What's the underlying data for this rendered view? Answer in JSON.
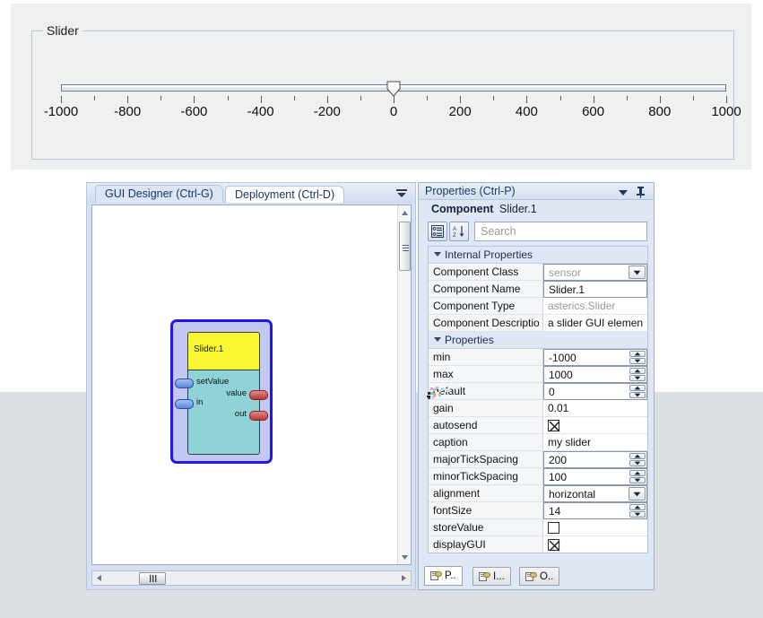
{
  "slider_window": {
    "group_title": "Slider",
    "caption": "my slider",
    "min": -1000,
    "max": 1000,
    "value": 0,
    "major_tick_spacing": 200,
    "minor_tick_spacing": 100,
    "tick_labels": [
      "-1000",
      "-800",
      "-600",
      "-400",
      "-200",
      "0",
      "200",
      "400",
      "600",
      "800",
      "1000"
    ]
  },
  "editor": {
    "tabs": [
      {
        "label": "GUI Designer (Ctrl-G)",
        "selected": true
      },
      {
        "label": "Deployment (Ctrl-D)",
        "selected": false
      }
    ],
    "overflow_icon": "chevron-down-icon",
    "canvas": {
      "component": {
        "title": "Slider.1",
        "inputs": [
          "setValue",
          "in"
        ],
        "outputs": [
          "value",
          "out"
        ]
      }
    },
    "scrollbars": {
      "vertical": {
        "up_icon": "arrow-up-icon",
        "down_icon": "arrow-down-icon"
      },
      "horizontal": {
        "left_icon": "arrow-left-icon",
        "right_icon": "arrow-right-icon"
      }
    }
  },
  "properties_panel": {
    "title": "Properties (Ctrl-P)",
    "collapse_icon": "chevron-down-icon",
    "pin_icon": "pin-icon",
    "component_label": "Component",
    "component_value": "Slider.1",
    "toolbar": {
      "categorize_icon": "categorize-icon",
      "sort_icon": "sort-az-icon",
      "search_placeholder": "Search",
      "search_value": ""
    },
    "sections": [
      {
        "name": "Internal Properties",
        "rows": [
          {
            "key": "Component Class",
            "value": "sensor",
            "editor": "combo",
            "muted": true
          },
          {
            "key": "Component Name",
            "value": "Slider.1",
            "editor": "text",
            "muted": false
          },
          {
            "key": "Component Type",
            "value": "asterics.Slider",
            "editor": "text-plain",
            "muted": true
          },
          {
            "key": "Component Descriptio",
            "value": "a slider GUI elemen",
            "editor": "text-plain",
            "muted": false
          }
        ]
      },
      {
        "name": "Properties",
        "rows": [
          {
            "key": "min",
            "value": "-1000",
            "editor": "spinner",
            "muted": false
          },
          {
            "key": "max",
            "value": "1000",
            "editor": "spinner",
            "muted": false
          },
          {
            "key": "default",
            "value": "0",
            "editor": "spinner",
            "muted": false
          },
          {
            "key": "gain",
            "value": "0.01",
            "editor": "text-plain",
            "muted": false
          },
          {
            "key": "autosend",
            "value": "checked",
            "editor": "checkbox",
            "muted": false
          },
          {
            "key": "caption",
            "value": "my slider",
            "editor": "text-plain",
            "muted": false
          },
          {
            "key": "majorTickSpacing",
            "value": "200",
            "editor": "spinner",
            "muted": false
          },
          {
            "key": "minorTickSpacing",
            "value": "100",
            "editor": "spinner",
            "muted": false
          },
          {
            "key": "alignment",
            "value": "horizontal",
            "editor": "combo",
            "muted": false
          },
          {
            "key": "fontSize",
            "value": "14",
            "editor": "spinner",
            "muted": false
          },
          {
            "key": "storeValue",
            "value": "unchecked",
            "editor": "checkbox",
            "muted": false
          },
          {
            "key": "displayGUI",
            "value": "checked",
            "editor": "checkbox",
            "muted": false
          }
        ]
      }
    ],
    "bottom_tabs": [
      {
        "label": "P..",
        "icon": "properties-tab-icon",
        "selected": true
      },
      {
        "label": "I...",
        "icon": "input-tab-icon",
        "selected": false
      },
      {
        "label": "O..",
        "icon": "output-tab-icon",
        "selected": false
      }
    ]
  },
  "colors": {
    "accent_blue": "#2414f0",
    "component_title": "#f7f732",
    "component_body": "#8fd2d8",
    "input_port": "#5d86d6",
    "output_port": "#b83a3a",
    "panel_bg": "#dfe7f5",
    "overlay_gray": "#dcdfe3"
  }
}
